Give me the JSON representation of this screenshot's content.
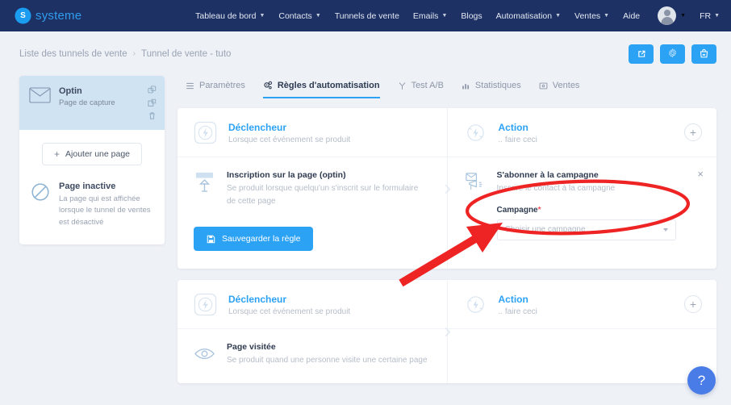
{
  "brand": {
    "name": "systeme",
    "mark": "S"
  },
  "topnav": {
    "items": [
      {
        "label": "Tableau de bord",
        "caret": true
      },
      {
        "label": "Contacts",
        "caret": true
      },
      {
        "label": "Tunnels de vente",
        "caret": false
      },
      {
        "label": "Emails",
        "caret": true
      },
      {
        "label": "Blogs",
        "caret": false
      },
      {
        "label": "Automatisation",
        "caret": true
      },
      {
        "label": "Ventes",
        "caret": true
      },
      {
        "label": "Aide",
        "caret": false
      }
    ],
    "language": "FR"
  },
  "breadcrumb": {
    "root": "Liste des tunnels de vente",
    "separator": "›",
    "current": "Tunnel de vente - tuto"
  },
  "crumb_actions": [
    {
      "name": "open-external-button",
      "icon": "external-link-icon"
    },
    {
      "name": "settings-button",
      "icon": "gear-icon"
    },
    {
      "name": "shop-button",
      "icon": "shopping-bag-icon"
    }
  ],
  "sidebar": {
    "page": {
      "title": "Optin",
      "subtitle": "Page de capture",
      "icon": "envelope-icon",
      "tools": [
        "duplicate-icon",
        "clone-page-icon",
        "trash-icon"
      ]
    },
    "add_page_label": "Ajouter une page",
    "add_page_plus": "+",
    "inactive": {
      "title": "Page inactive",
      "description": "La page qui est affichée lorsque le tunnel de ventes est désactivé",
      "icon": "ban-icon"
    }
  },
  "tabs": [
    {
      "label": "Paramètres",
      "icon": "list-icon",
      "active": false
    },
    {
      "label": "Règles d'automatisation",
      "icon": "gears-icon",
      "active": true
    },
    {
      "label": "Test A/B",
      "icon": "split-icon",
      "active": false
    },
    {
      "label": "Statistiques",
      "icon": "bar-chart-icon",
      "active": false
    },
    {
      "label": "Ventes",
      "icon": "sales-icon",
      "active": false
    }
  ],
  "rules": [
    {
      "trigger": {
        "head_title": "Déclencheur",
        "head_sub": "Lorsque cet événement se produit",
        "head_icon": "bolt-square-icon",
        "item_title": "Inscription sur la page (optin)",
        "item_desc": "Se produit lorsque quelqu'un s'inscrit sur le formulaire de cette page",
        "item_icon": "subscribe-arrow-icon"
      },
      "action": {
        "head_title": "Action",
        "head_sub": ".. faire ceci",
        "head_icon": "bolt-circle-icon",
        "add_label": "+",
        "item_title": "S'abonner à la campagne",
        "item_desc": "Inscrire le contact à la campagne",
        "item_icon": "mail-megaphone-icon",
        "close_label": "×",
        "field_label": "Campagne",
        "field_required_mark": "*",
        "field_placeholder": "Choisir une campagne"
      },
      "save_label": "Sauvegarder la règle",
      "save_icon": "floppy-disk-icon"
    },
    {
      "trigger": {
        "head_title": "Déclencheur",
        "head_sub": "Lorsque cet événement se produit",
        "head_icon": "bolt-square-icon",
        "item_title": "Page visitée",
        "item_desc": "Se produit quand une personne visite une certaine page",
        "item_icon": "eye-icon"
      },
      "action": {
        "head_title": "Action",
        "head_sub": ".. faire ceci",
        "head_icon": "bolt-circle-icon",
        "add_label": "+"
      }
    }
  ],
  "help": {
    "label": "?"
  },
  "colors": {
    "nav_bg": "#1d3164",
    "accent": "#2ca2f5",
    "page_bg": "#eef1f6",
    "annotation": "#ee2424",
    "required": "#f2545b",
    "help_bg": "#4a7ce8"
  }
}
